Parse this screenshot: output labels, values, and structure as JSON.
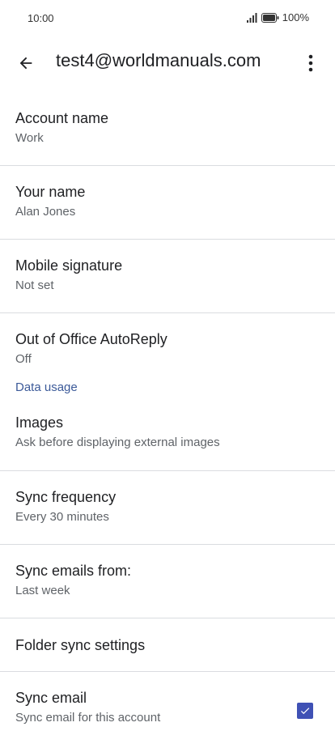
{
  "status_bar": {
    "time": "10:00",
    "battery": "100%"
  },
  "app_bar": {
    "title": "test4@worldmanuals.com"
  },
  "settings": {
    "account_name": {
      "title": "Account name",
      "value": "Work"
    },
    "your_name": {
      "title": "Your name",
      "value": "Alan Jones"
    },
    "mobile_signature": {
      "title": "Mobile signature",
      "value": "Not set"
    },
    "out_of_office": {
      "title": "Out of Office AutoReply",
      "value": "Off"
    },
    "data_usage_header": "Data usage",
    "images": {
      "title": "Images",
      "value": "Ask before displaying external images"
    },
    "sync_frequency": {
      "title": "Sync frequency",
      "value": "Every 30 minutes"
    },
    "sync_emails_from": {
      "title": "Sync emails from:",
      "value": "Last week"
    },
    "folder_sync": {
      "title": "Folder sync settings"
    },
    "sync_email": {
      "title": "Sync email",
      "value": "Sync email for this account",
      "checked": true
    }
  },
  "colors": {
    "accent": "#3f51b5",
    "section_header": "#3c5a99"
  },
  "icons": {
    "back": "arrow-left-icon",
    "more": "more-vert-icon",
    "check": "check-icon"
  }
}
